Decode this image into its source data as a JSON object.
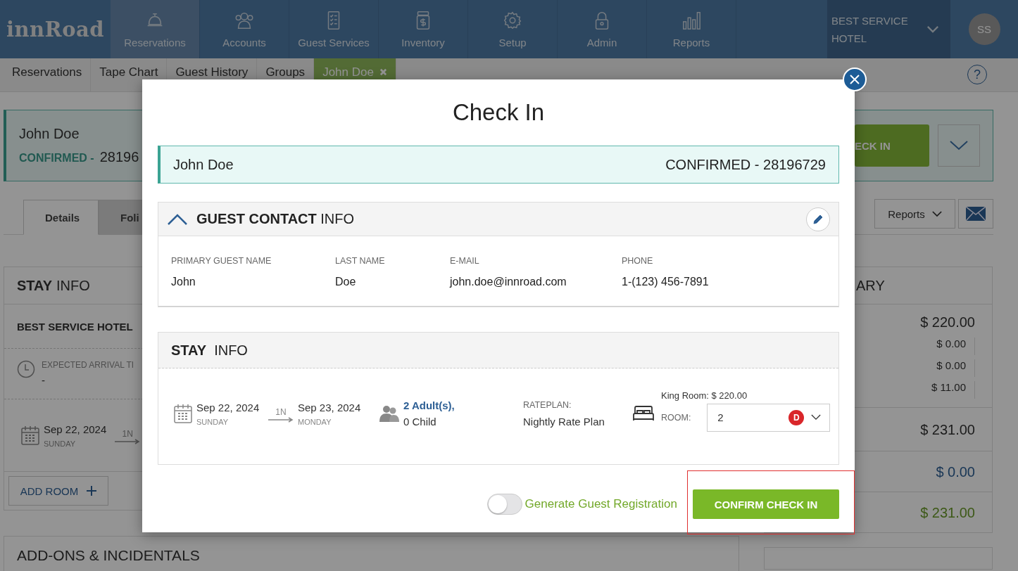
{
  "nav": {
    "logo": "innRoad",
    "items": [
      {
        "label": "Reservations",
        "kind": "bell",
        "selected": true
      },
      {
        "label": "Accounts",
        "kind": "people",
        "selected": false
      },
      {
        "label": "Guest Services",
        "kind": "list",
        "selected": false
      },
      {
        "label": "Inventory",
        "kind": "jar",
        "selected": false
      },
      {
        "label": "Setup",
        "kind": "gear",
        "selected": false
      },
      {
        "label": "Admin",
        "kind": "lock",
        "selected": false
      },
      {
        "label": "Reports",
        "kind": "bars",
        "selected": false
      }
    ],
    "hotel": "BEST SERVICE HOTEL",
    "avatar": "SS"
  },
  "subnav": {
    "items": [
      {
        "label": "Reservations",
        "selected": false
      },
      {
        "label": "Tape Chart",
        "selected": false
      },
      {
        "label": "Guest History",
        "selected": false
      },
      {
        "label": "Groups",
        "selected": false
      },
      {
        "label": "John Doe",
        "selected": true
      }
    ],
    "help": "?"
  },
  "reservation": {
    "name": "John Doe",
    "status": "CONFIRMED -",
    "number": "28196",
    "check_in": "ECK IN"
  },
  "tabs": [
    {
      "label": "Details",
      "selected": true
    },
    {
      "label": "Foli",
      "selected": false
    }
  ],
  "reports_button": "Reports",
  "stay_panel": {
    "title_bold": "STAY",
    "title_rest": "INFO",
    "hotel": "BEST SERVICE HOTEL",
    "arrival_label": "EXPECTED ARRIVAL TI",
    "arrival_value": "-",
    "date": "Sep 22, 2024",
    "day": "SUNDAY",
    "nights": "1N",
    "add_room": "ADD ROOM"
  },
  "addons_title": "ADD-ONS & INCIDENTALS",
  "summary": {
    "title": "ARY",
    "sections": [
      {
        "rows": [
          {
            "value": "$ 220.00",
            "kind": "main"
          },
          {
            "value": "$ 0.00",
            "kind": "sub"
          },
          {
            "value": "$ 0.00",
            "kind": "sub"
          },
          {
            "value": "$ 11.00",
            "kind": "sub"
          }
        ]
      },
      {
        "rows": [
          {
            "value": "$ 231.00",
            "kind": "total"
          }
        ]
      },
      {
        "rows": [
          {
            "value": "$ 0.00",
            "kind": "paid"
          }
        ]
      },
      {
        "rows": [
          {
            "value": "$ 231.00",
            "kind": "balance"
          }
        ]
      }
    ]
  },
  "modal": {
    "title": "Check In",
    "guest": {
      "name": "John Doe",
      "status": "CONFIRMED - 28196729"
    },
    "contact": {
      "title_bold": "GUEST CONTACT",
      "title_rest": "INFO",
      "expanded": true,
      "fields": [
        {
          "label": "PRIMARY GUEST NAME",
          "value": "John"
        },
        {
          "label": "LAST NAME",
          "value": "Doe"
        },
        {
          "label": "E-MAIL",
          "value": "john.doe@innroad.com"
        },
        {
          "label": "PHONE",
          "value": "1-(123) 456-7891"
        }
      ]
    },
    "stay": {
      "title_bold": "STAY",
      "title_rest": "INFO",
      "arrival": {
        "date": "Sep 22, 2024",
        "day": "SUNDAY"
      },
      "nights": "1N",
      "departure": {
        "date": "Sep 23, 2024",
        "day": "MONDAY"
      },
      "adults": "2 Adult(s),",
      "children": "0 Child",
      "rateplan_label": "RATEPLAN:",
      "rateplan": "Nightly Rate Plan",
      "room_type": "King Room: $ 220.00",
      "room_label": "ROOM:",
      "room": "2",
      "room_status": "D"
    },
    "registration": {
      "on": false,
      "label": "Generate Guest Registration"
    },
    "confirm": "CONFIRM CHECK IN"
  }
}
